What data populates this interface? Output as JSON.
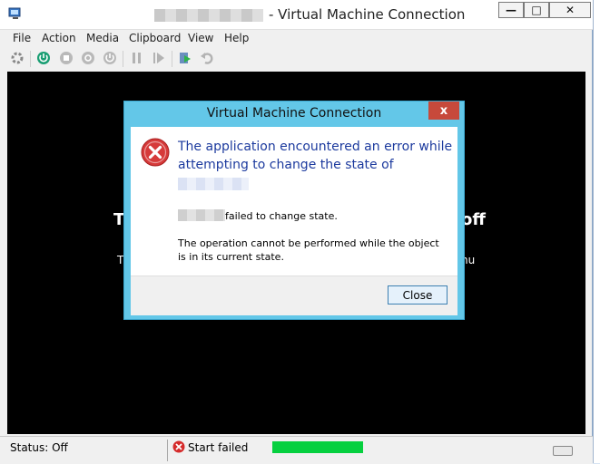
{
  "window": {
    "title": "- Virtual Machine Connection",
    "min": "—",
    "max": "□",
    "close": "✕"
  },
  "menu": [
    "File",
    "Action",
    "Media",
    "Clipboard",
    "View",
    "Help"
  ],
  "background_fragments": {
    "left_big": "T",
    "right_big": "off",
    "left_small": "T",
    "right_small": "nu"
  },
  "dialog": {
    "title": "Virtual Machine Connection",
    "close_glyph": "x",
    "main_instruction": "The application encountered an error while attempting to change the state of",
    "line1": "failed to change state.",
    "line2": "The operation cannot be performed while the object is in its current state.",
    "close_label": "Close"
  },
  "status": {
    "state": "Status: Off",
    "message": "Start failed",
    "progress": 1.0
  },
  "colors": {
    "dialog_frame": "#63c7e8",
    "instruction_blue": "#1c3a9e",
    "progress_green": "#06d03f",
    "close_red": "#c7493b"
  },
  "icons": [
    "app-icon",
    "ctrl-alt-del-icon",
    "start-icon",
    "turn-off-icon",
    "shutdown-icon",
    "save-icon",
    "pause-icon",
    "reset-icon",
    "checkpoint-icon",
    "revert-icon",
    "error-icon",
    "keyboard-icon"
  ]
}
